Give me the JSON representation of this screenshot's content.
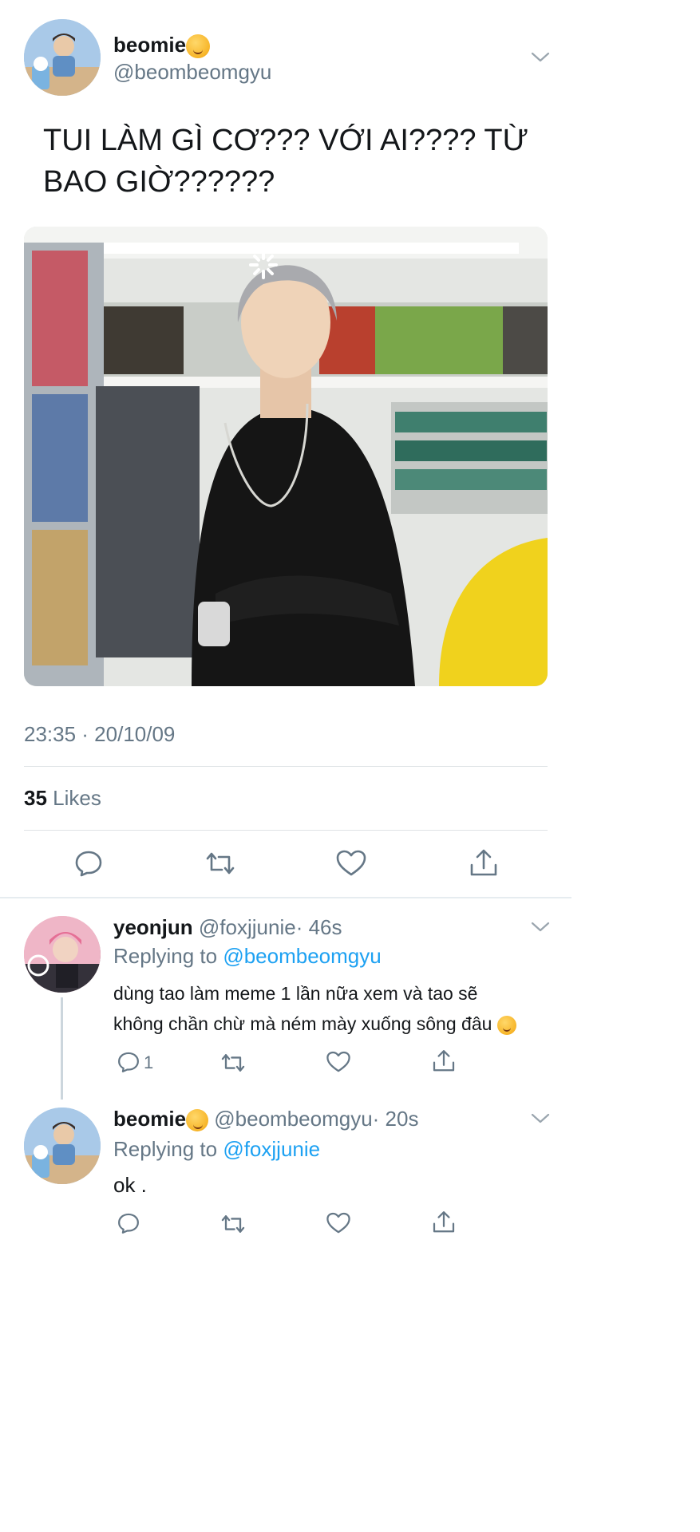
{
  "tweet": {
    "display_name": "beomie",
    "name_emoji": "smiling-face-with-hearts",
    "handle": "@beombeomgyu",
    "text_line1": "TUI LÀM GÌ CƠ??? VỚI AI???? TỪ",
    "text_line2": "BAO GIỜ??????",
    "timestamp": "23:35 · 20/10/09",
    "likes_count": "35",
    "likes_label": "Likes",
    "actions": [
      "reply-icon",
      "retweet-icon",
      "like-icon",
      "share-icon"
    ]
  },
  "replies": [
    {
      "display_name": "yeonjun",
      "handle": "@foxjjunie",
      "time": "· 46s",
      "replying_prefix": "Replying to",
      "replying_to": "@beombeomgyu",
      "text_line1": "dùng tao làm meme 1 lần nữa xem và tao sẽ",
      "text_line2": "không chần chừ mà ném mày xuống sông đâu",
      "reply_count": "1"
    },
    {
      "display_name": "beomie",
      "handle": "@beombeomgyu",
      "time": "· 20s",
      "replying_prefix": "Replying to",
      "replying_to": "@foxjjunie",
      "text": "ok ."
    }
  ],
  "colors": {
    "link": "#1da1f2",
    "muted": "#657786",
    "text": "#14171a",
    "divider": "#dfe3e6"
  }
}
